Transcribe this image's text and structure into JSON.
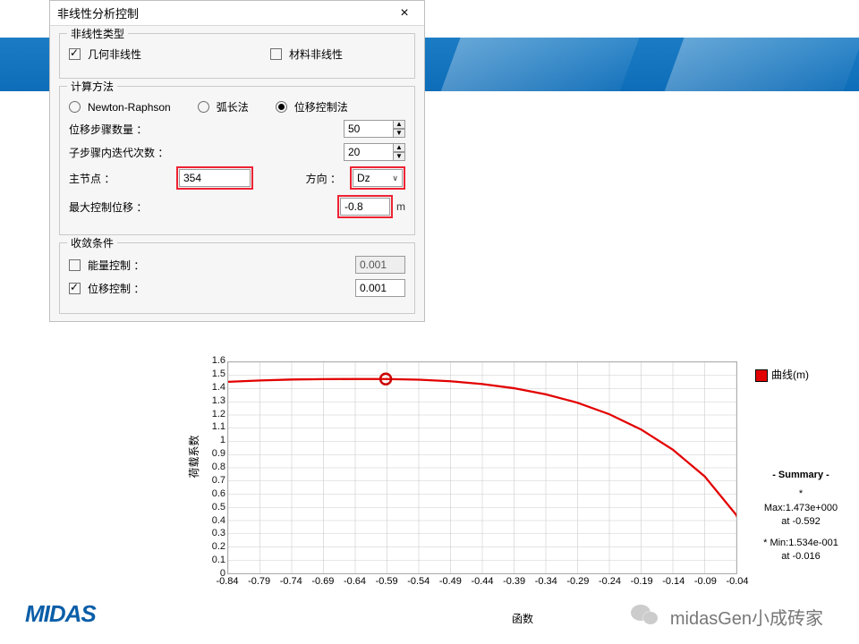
{
  "dialog": {
    "title": "非线性分析控制",
    "group_type": {
      "title": "非线性类型",
      "geom": "几何非线性",
      "material": "材料非线性"
    },
    "group_method": {
      "title": "计算方法",
      "newton": "Newton-Raphson",
      "arc": "弧长法",
      "disp": "位移控制法",
      "steps_label": "位移步骤数量 ：",
      "steps_val": "50",
      "iter_label": "子步骤内迭代次数 ：",
      "iter_val": "20",
      "master_label": "主节点 ：",
      "master_val": "354",
      "dir_label": "方向 ：",
      "dir_val": "Dz",
      "maxdisp_label": "最大控制位移 ：",
      "maxdisp_val": "-0.8",
      "maxdisp_unit": "m"
    },
    "group_conv": {
      "title": "收敛条件",
      "energy": "能量控制 ：",
      "energy_val": "0.001",
      "disp": "位移控制 ：",
      "disp_val": "0.001"
    }
  },
  "chart": {
    "yaxis": "荷载系数",
    "xaxis": "函数",
    "legend": "曲线(m)",
    "summary_title": "- Summary -",
    "summary_star": "*",
    "summary_max": "Max:1.473e+000",
    "summary_max_at": "at -0.592",
    "summary_min": "* Min:1.534e-001",
    "summary_min_at": "at -0.016"
  },
  "chart_data": {
    "type": "line",
    "xlabel": "函数",
    "ylabel": "荷载系数",
    "xlim": [
      -0.84,
      -0.04
    ],
    "ylim": [
      0,
      1.6
    ],
    "x_ticks": [
      "-0.84",
      "-0.79",
      "-0.74",
      "-0.69",
      "-0.64",
      "-0.59",
      "-0.54",
      "-0.49",
      "-0.44",
      "-0.39",
      "-0.34",
      "-0.29",
      "-0.24",
      "-0.19",
      "-0.14",
      "-0.09",
      "-0.04"
    ],
    "y_ticks": [
      "0",
      "0.1",
      "0.2",
      "0.3",
      "0.4",
      "0.5",
      "0.6",
      "0.7",
      "0.8",
      "0.9",
      "1",
      "1.1",
      "1.2",
      "1.3",
      "1.4",
      "1.5",
      "1.6"
    ],
    "series": [
      {
        "name": "曲线(m)",
        "color": "#e20000",
        "x": [
          -0.84,
          -0.79,
          -0.74,
          -0.69,
          -0.64,
          -0.592,
          -0.54,
          -0.49,
          -0.44,
          -0.39,
          -0.34,
          -0.29,
          -0.24,
          -0.19,
          -0.14,
          -0.09,
          -0.04,
          -0.016
        ],
        "y": [
          1.452,
          1.462,
          1.469,
          1.472,
          1.473,
          1.473,
          1.468,
          1.456,
          1.435,
          1.403,
          1.357,
          1.293,
          1.206,
          1.09,
          0.937,
          0.735,
          0.441,
          0.153
        ]
      }
    ],
    "marker": {
      "x": -0.592,
      "y": 1.473
    },
    "max": {
      "value": 1.473,
      "at": -0.592
    },
    "min": {
      "value": 0.1534,
      "at": -0.016
    }
  },
  "footer": {
    "logo": "MIDAS",
    "wechat": "midasGen小成砖家"
  }
}
